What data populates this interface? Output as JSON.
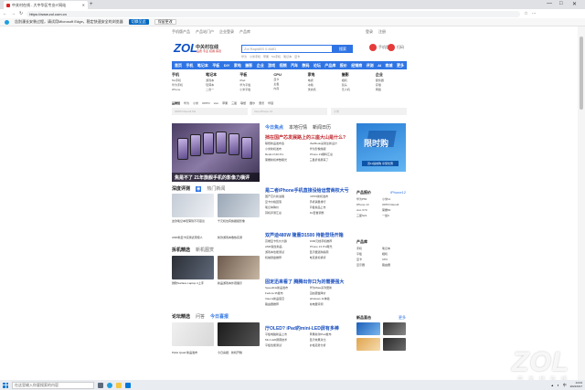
{
  "browser": {
    "tab_title": "中关村在线 - 大中华区专业IT网站",
    "url": "https://www.zol.com.cn",
    "infobar_text": "告别漫长安装过程，请试用Microsoft Edge，稳定快速安全的浏览器",
    "infobar_primary": "切换至此",
    "infobar_secondary": "保留更改"
  },
  "site": {
    "top_links": [
      "手机版产品",
      "产品站门户",
      "企业登录",
      "产品库"
    ],
    "top_links_right": [
      "登录",
      "注册"
    ],
    "logo": "ZOL",
    "logo_name": "中关村在线",
    "slogan": "品质·专业·权威·客观",
    "search_placeholder": "Zol Rapid5S 0 AMD",
    "search_button": "搜索",
    "hot_words": [
      "华为",
      "小米手机",
      "苹果",
      "5G手机",
      "笔记本",
      "显卡"
    ],
    "social_left": "手机版",
    "social_right": "扫码"
  },
  "nav": [
    "首页",
    "手机",
    "笔记本",
    "平板",
    "DIY",
    "家电",
    "摄影",
    "企业",
    "游戏",
    "视频",
    "汽车",
    "数码",
    "论坛",
    "产品库",
    "报价",
    "经销商",
    "评测",
    "AI",
    "商城",
    "更多"
  ],
  "categories": [
    {
      "head": "手机",
      "links": [
        "5G手机",
        "华为手机",
        "iPhone"
      ]
    },
    {
      "head": "笔记本",
      "links": [
        "游戏本",
        "轻薄本",
        "二合一"
      ]
    },
    {
      "head": "平板",
      "links": [
        "iPad",
        "华为平板",
        "小米平板"
      ]
    },
    {
      "head": "CPU",
      "links": [
        "显卡",
        "主板",
        "内存"
      ]
    },
    {
      "head": "家电",
      "links": [
        "电视",
        "冰箱",
        "洗衣机"
      ]
    },
    {
      "head": "摄影",
      "links": [
        "相机",
        "镜头",
        "无人机"
      ]
    },
    {
      "head": "企业",
      "links": [
        "服务器",
        "存储",
        "网络"
      ]
    }
  ],
  "brand_row": [
    "品牌馆",
    "华为",
    "小米",
    "OPPO",
    "vivo",
    "苹果",
    "三星",
    "联想",
    "戴尔",
    "惠普",
    "华硕"
  ],
  "ads": [
    "OPPO Reno6 5G",
    "Vivo iPhone 13",
    "小米"
  ],
  "slide_caption": "焦是不了 21年旗舰手机的影像力横评",
  "section_eval": {
    "title": "深度评测",
    "tab": "热门新闻",
    "items": [
      "这款笔记本轻薄到不可思议",
      "千元机也有旗舰级影像",
      "AMD新显卡实测表现惊人",
      "新款游戏本散热实测"
    ]
  },
  "section_tech": {
    "title": "拆机精选",
    "tab": "新机图赏",
    "items": [
      "微软Surface Laptop 4上手",
      "新品游戏本外观展示"
    ]
  },
  "section_forum": {
    "title": "论坛精选",
    "tab": "问答",
    "tab2": "今日喜报",
    "items": [
      "Pelisi Quad 新品发布",
      "今日喜报：新机开箱"
    ]
  },
  "center_tabs": [
    "今日焦点",
    "本地行情",
    "新闻日历"
  ],
  "headlines": [
    {
      "text": "挡在国产芯发展路上的三座大山是什么?",
      "red": true
    },
    {
      "text": "是二者iPhone手机直接没给运营商权大亏",
      "red": false
    },
    {
      "text": "双芦迪480W 隆重D1500 待能登场开箱",
      "red": false
    },
    {
      "text": "固定迅来看了 腾腾出你口为的需要强大",
      "red": false
    },
    {
      "text": "厅OLED? iPad的mini-LED屏有多棒",
      "red": false
    }
  ],
  "news_lists": [
    [
      "联想新品发布会",
      "MacBook采用全新设计",
      "小米新机发布",
      "华为影像旗舰",
      "Redmi K40 Pro",
      "iPhone 13爆料汇总",
      "荣耀新机参数曝光",
      "三星折叠屏来了"
    ],
    [
      "国产芯片新进展",
      "OPPO新机发布",
      "显卡价格回落",
      "手机销量排行",
      "笔记本降价",
      "平板新品上市",
      "耳机评测汇总",
      "5G套餐调整"
    ],
    [
      "高端显卡售价大跌",
      "2000元档手机推荐",
      "AMD锐龙新品",
      "iPhone 13 Pro曝光",
      "游戏本性能测试",
      "显示器选购指南",
      "机械键盘推荐",
      "电竞鼠标横评"
    ],
    [
      "Speedlink新品发布",
      "华为Mate系列更新",
      "Fedora 35发布",
      "固态硬盘降价",
      "Xiaomi新品官宣",
      "Windows 11体验",
      "路由器推荐",
      "充电器评测"
    ],
    [
      "平板电脑新品上市",
      "苹果新款iPad发布",
      "Mini LED屏幕技术",
      "显示效果对比",
      "平板性能测试",
      "价格走势分析"
    ]
  ],
  "right_ad": {
    "title": "限时购",
    "sub": "双11提前购 享受优惠"
  },
  "right_product": {
    "head": "产品报价",
    "more": "iPhone12",
    "items": [
      "华为P50",
      "小米11",
      "iPhone 13",
      "OPPO Reno6",
      "vivo X70",
      "荣耀50",
      "三星S21",
      "一加9"
    ]
  },
  "right_store": {
    "head": "产品库",
    "items": [
      "手机",
      "笔记本",
      "平板",
      "相机",
      "显卡",
      "CPU",
      "显示器",
      "路由器"
    ]
  },
  "right_new": {
    "head": "新品直击",
    "more": "更多"
  },
  "taskbar": {
    "search_placeholder": "在这里输入你要搜索的内容",
    "time": "14:04",
    "date": "2021/9/17",
    "lang": "中"
  },
  "watermark": {
    "logo": "ZOL",
    "sub": "中关村在线"
  }
}
